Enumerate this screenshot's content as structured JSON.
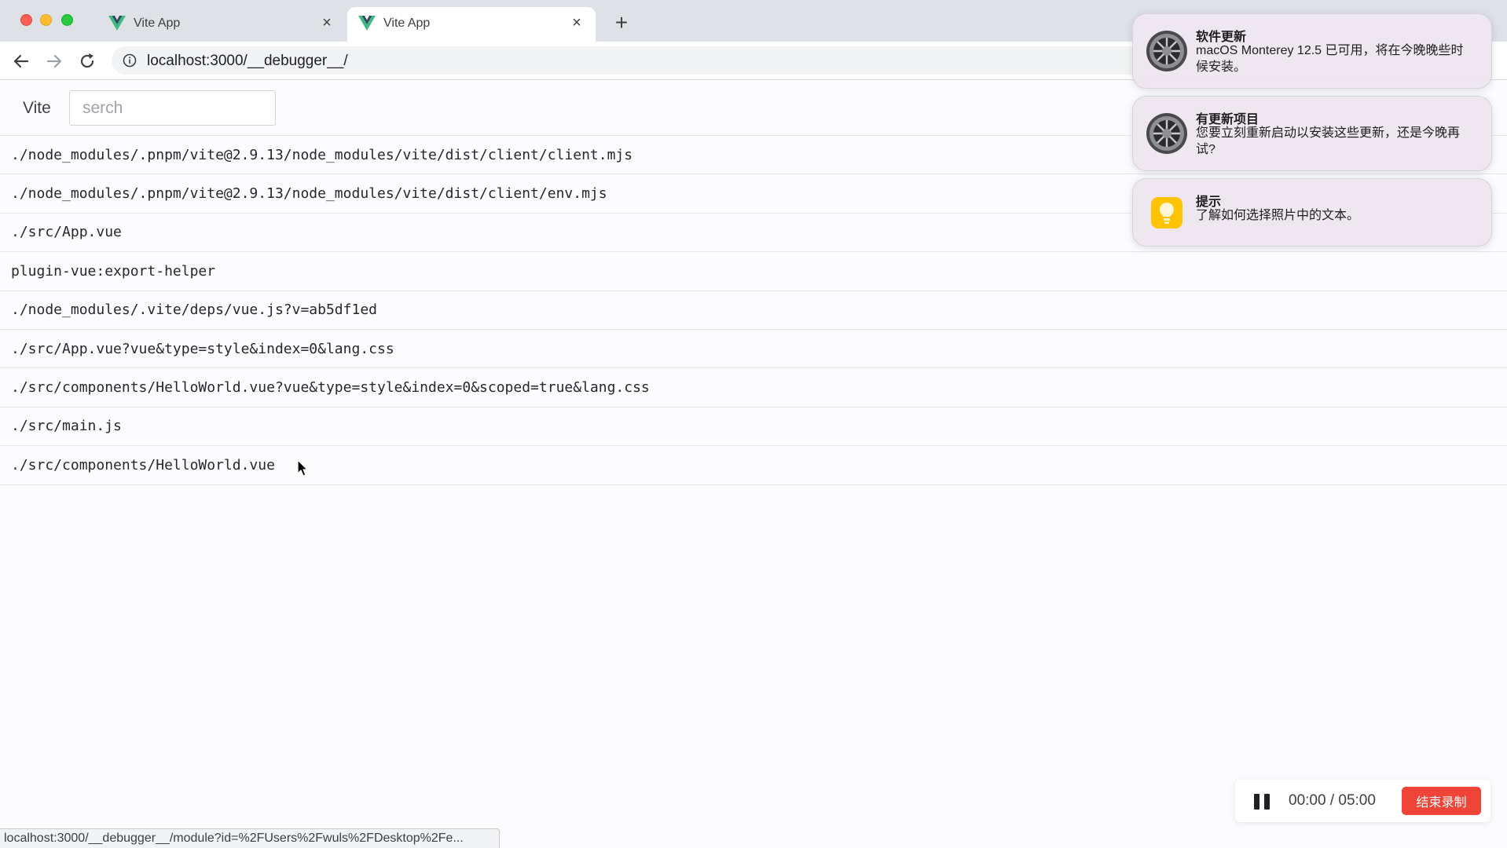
{
  "browser": {
    "tabs": [
      {
        "title": "Vite App",
        "close_glyph": "×",
        "active": false,
        "icon": "vue-logo-icon"
      },
      {
        "title": "Vite App",
        "close_glyph": "×",
        "active": true,
        "icon": "vue-logo-icon"
      }
    ],
    "new_tab_glyph": "+",
    "url": "localhost:3000/__debugger__/",
    "status_url": "localhost:3000/__debugger__/module?id=%2FUsers%2Fwuls%2FDesktop%2Fe..."
  },
  "page": {
    "brand": "Vite",
    "search": {
      "placeholder": "serch",
      "value": ""
    },
    "modules": [
      "./node_modules/.pnpm/vite@2.9.13/node_modules/vite/dist/client/client.mjs",
      "./node_modules/.pnpm/vite@2.9.13/node_modules/vite/dist/client/env.mjs",
      "./src/App.vue",
      "plugin-vue:export-helper",
      "./node_modules/.vite/deps/vue.js?v=ab5df1ed",
      "./src/App.vue?vue&type=style&index=0&lang.css",
      "./src/components/HelloWorld.vue?vue&type=style&index=0&scoped=true&lang.css",
      "./src/main.js",
      "./src/components/HelloWorld.vue"
    ]
  },
  "notifications": [
    {
      "title": "软件更新",
      "body": "macOS Monterey 12.5 已可用，将在今晚晚些时候安装。",
      "icon": "system-preferences-icon"
    },
    {
      "title": "有更新项目",
      "body": "您要立刻重新启动以安装这些更新，还是今晚再试?",
      "icon": "system-preferences-icon"
    },
    {
      "title": "提示",
      "body": "了解如何选择照片中的文本。",
      "icon": "tips-lightbulb-icon"
    }
  ],
  "recorder": {
    "time": "00:00 / 05:00",
    "stop_label": "结束录制",
    "stop_color": "#f04438"
  },
  "colors": {
    "vue_green": "#41b883",
    "vue_dark": "#34495e",
    "tab_strip": "#dee1e6"
  }
}
